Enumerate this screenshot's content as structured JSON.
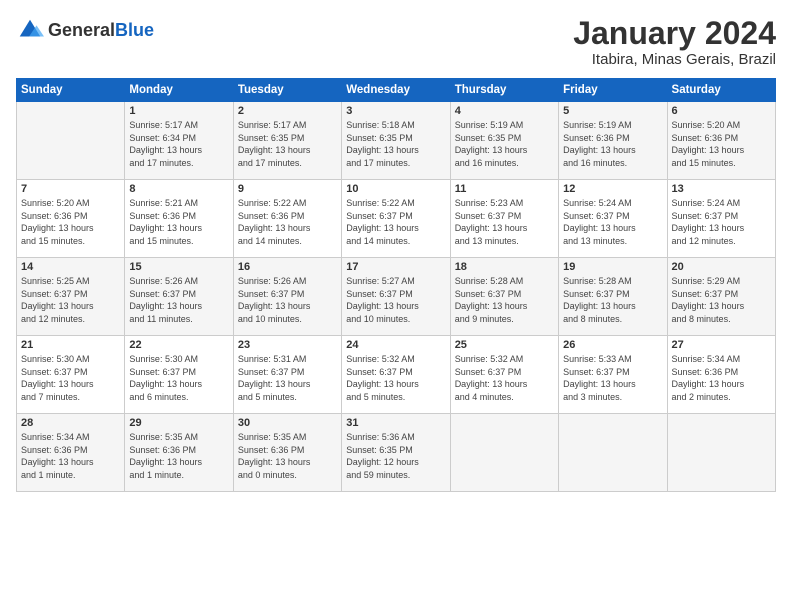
{
  "logo": {
    "general": "General",
    "blue": "Blue"
  },
  "header": {
    "month": "January 2024",
    "location": "Itabira, Minas Gerais, Brazil"
  },
  "weekdays": [
    "Sunday",
    "Monday",
    "Tuesday",
    "Wednesday",
    "Thursday",
    "Friday",
    "Saturday"
  ],
  "weeks": [
    [
      {
        "day": "",
        "content": ""
      },
      {
        "day": "1",
        "content": "Sunrise: 5:17 AM\nSunset: 6:34 PM\nDaylight: 13 hours\nand 17 minutes."
      },
      {
        "day": "2",
        "content": "Sunrise: 5:17 AM\nSunset: 6:35 PM\nDaylight: 13 hours\nand 17 minutes."
      },
      {
        "day": "3",
        "content": "Sunrise: 5:18 AM\nSunset: 6:35 PM\nDaylight: 13 hours\nand 17 minutes."
      },
      {
        "day": "4",
        "content": "Sunrise: 5:19 AM\nSunset: 6:35 PM\nDaylight: 13 hours\nand 16 minutes."
      },
      {
        "day": "5",
        "content": "Sunrise: 5:19 AM\nSunset: 6:36 PM\nDaylight: 13 hours\nand 16 minutes."
      },
      {
        "day": "6",
        "content": "Sunrise: 5:20 AM\nSunset: 6:36 PM\nDaylight: 13 hours\nand 15 minutes."
      }
    ],
    [
      {
        "day": "7",
        "content": "Sunrise: 5:20 AM\nSunset: 6:36 PM\nDaylight: 13 hours\nand 15 minutes."
      },
      {
        "day": "8",
        "content": "Sunrise: 5:21 AM\nSunset: 6:36 PM\nDaylight: 13 hours\nand 15 minutes."
      },
      {
        "day": "9",
        "content": "Sunrise: 5:22 AM\nSunset: 6:36 PM\nDaylight: 13 hours\nand 14 minutes."
      },
      {
        "day": "10",
        "content": "Sunrise: 5:22 AM\nSunset: 6:37 PM\nDaylight: 13 hours\nand 14 minutes."
      },
      {
        "day": "11",
        "content": "Sunrise: 5:23 AM\nSunset: 6:37 PM\nDaylight: 13 hours\nand 13 minutes."
      },
      {
        "day": "12",
        "content": "Sunrise: 5:24 AM\nSunset: 6:37 PM\nDaylight: 13 hours\nand 13 minutes."
      },
      {
        "day": "13",
        "content": "Sunrise: 5:24 AM\nSunset: 6:37 PM\nDaylight: 13 hours\nand 12 minutes."
      }
    ],
    [
      {
        "day": "14",
        "content": "Sunrise: 5:25 AM\nSunset: 6:37 PM\nDaylight: 13 hours\nand 12 minutes."
      },
      {
        "day": "15",
        "content": "Sunrise: 5:26 AM\nSunset: 6:37 PM\nDaylight: 13 hours\nand 11 minutes."
      },
      {
        "day": "16",
        "content": "Sunrise: 5:26 AM\nSunset: 6:37 PM\nDaylight: 13 hours\nand 10 minutes."
      },
      {
        "day": "17",
        "content": "Sunrise: 5:27 AM\nSunset: 6:37 PM\nDaylight: 13 hours\nand 10 minutes."
      },
      {
        "day": "18",
        "content": "Sunrise: 5:28 AM\nSunset: 6:37 PM\nDaylight: 13 hours\nand 9 minutes."
      },
      {
        "day": "19",
        "content": "Sunrise: 5:28 AM\nSunset: 6:37 PM\nDaylight: 13 hours\nand 8 minutes."
      },
      {
        "day": "20",
        "content": "Sunrise: 5:29 AM\nSunset: 6:37 PM\nDaylight: 13 hours\nand 8 minutes."
      }
    ],
    [
      {
        "day": "21",
        "content": "Sunrise: 5:30 AM\nSunset: 6:37 PM\nDaylight: 13 hours\nand 7 minutes."
      },
      {
        "day": "22",
        "content": "Sunrise: 5:30 AM\nSunset: 6:37 PM\nDaylight: 13 hours\nand 6 minutes."
      },
      {
        "day": "23",
        "content": "Sunrise: 5:31 AM\nSunset: 6:37 PM\nDaylight: 13 hours\nand 5 minutes."
      },
      {
        "day": "24",
        "content": "Sunrise: 5:32 AM\nSunset: 6:37 PM\nDaylight: 13 hours\nand 5 minutes."
      },
      {
        "day": "25",
        "content": "Sunrise: 5:32 AM\nSunset: 6:37 PM\nDaylight: 13 hours\nand 4 minutes."
      },
      {
        "day": "26",
        "content": "Sunrise: 5:33 AM\nSunset: 6:37 PM\nDaylight: 13 hours\nand 3 minutes."
      },
      {
        "day": "27",
        "content": "Sunrise: 5:34 AM\nSunset: 6:36 PM\nDaylight: 13 hours\nand 2 minutes."
      }
    ],
    [
      {
        "day": "28",
        "content": "Sunrise: 5:34 AM\nSunset: 6:36 PM\nDaylight: 13 hours\nand 1 minute."
      },
      {
        "day": "29",
        "content": "Sunrise: 5:35 AM\nSunset: 6:36 PM\nDaylight: 13 hours\nand 1 minute."
      },
      {
        "day": "30",
        "content": "Sunrise: 5:35 AM\nSunset: 6:36 PM\nDaylight: 13 hours\nand 0 minutes."
      },
      {
        "day": "31",
        "content": "Sunrise: 5:36 AM\nSunset: 6:35 PM\nDaylight: 12 hours\nand 59 minutes."
      },
      {
        "day": "",
        "content": ""
      },
      {
        "day": "",
        "content": ""
      },
      {
        "day": "",
        "content": ""
      }
    ]
  ]
}
